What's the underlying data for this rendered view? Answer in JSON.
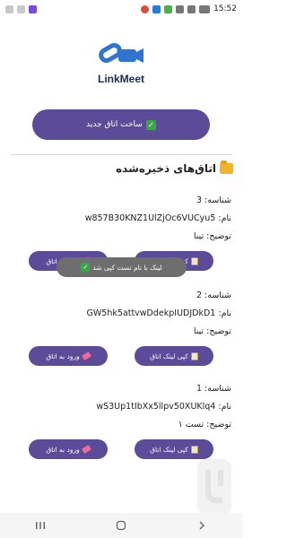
{
  "status_bar": {
    "time": "15:52",
    "battery": "89"
  },
  "logo": {
    "name": "LinkMeet"
  },
  "create_button": {
    "label": "ساخت اتاق جدید"
  },
  "saved_section": {
    "title": "اتاق‌های ذخیره‌شده"
  },
  "rooms": [
    {
      "id_line": "شناسه: 3",
      "name_line": "نام: w857B30KNZ1UlZjOc6VUCyu5",
      "desc_line": "توضیح: تینا",
      "copy_label": "کپی لینک اتاق",
      "enter_label": "ورود به اتاق"
    },
    {
      "id_line": "شناسه: 2",
      "name_line": "نام: GW5hk5attvwDdekpIUDJDkD1",
      "desc_line": "توضیح: تینا",
      "copy_label": "کپی لینک اتاق",
      "enter_label": "ورود به اتاق"
    },
    {
      "id_line": "شناسه: 1",
      "name_line": "نام: wS3Up1tIbXx5llpv50XUKlq4",
      "desc_line": "توضیح: تست ۱",
      "copy_label": "کپی لینک اتاق",
      "enter_label": "ورود به اتاق"
    }
  ],
  "toast": {
    "message": "لینک با نام تست کپی شد"
  },
  "nav_bar": {
    "recents_icon": "recents-icon",
    "home_icon": "home-icon",
    "back_icon": "back-icon"
  }
}
